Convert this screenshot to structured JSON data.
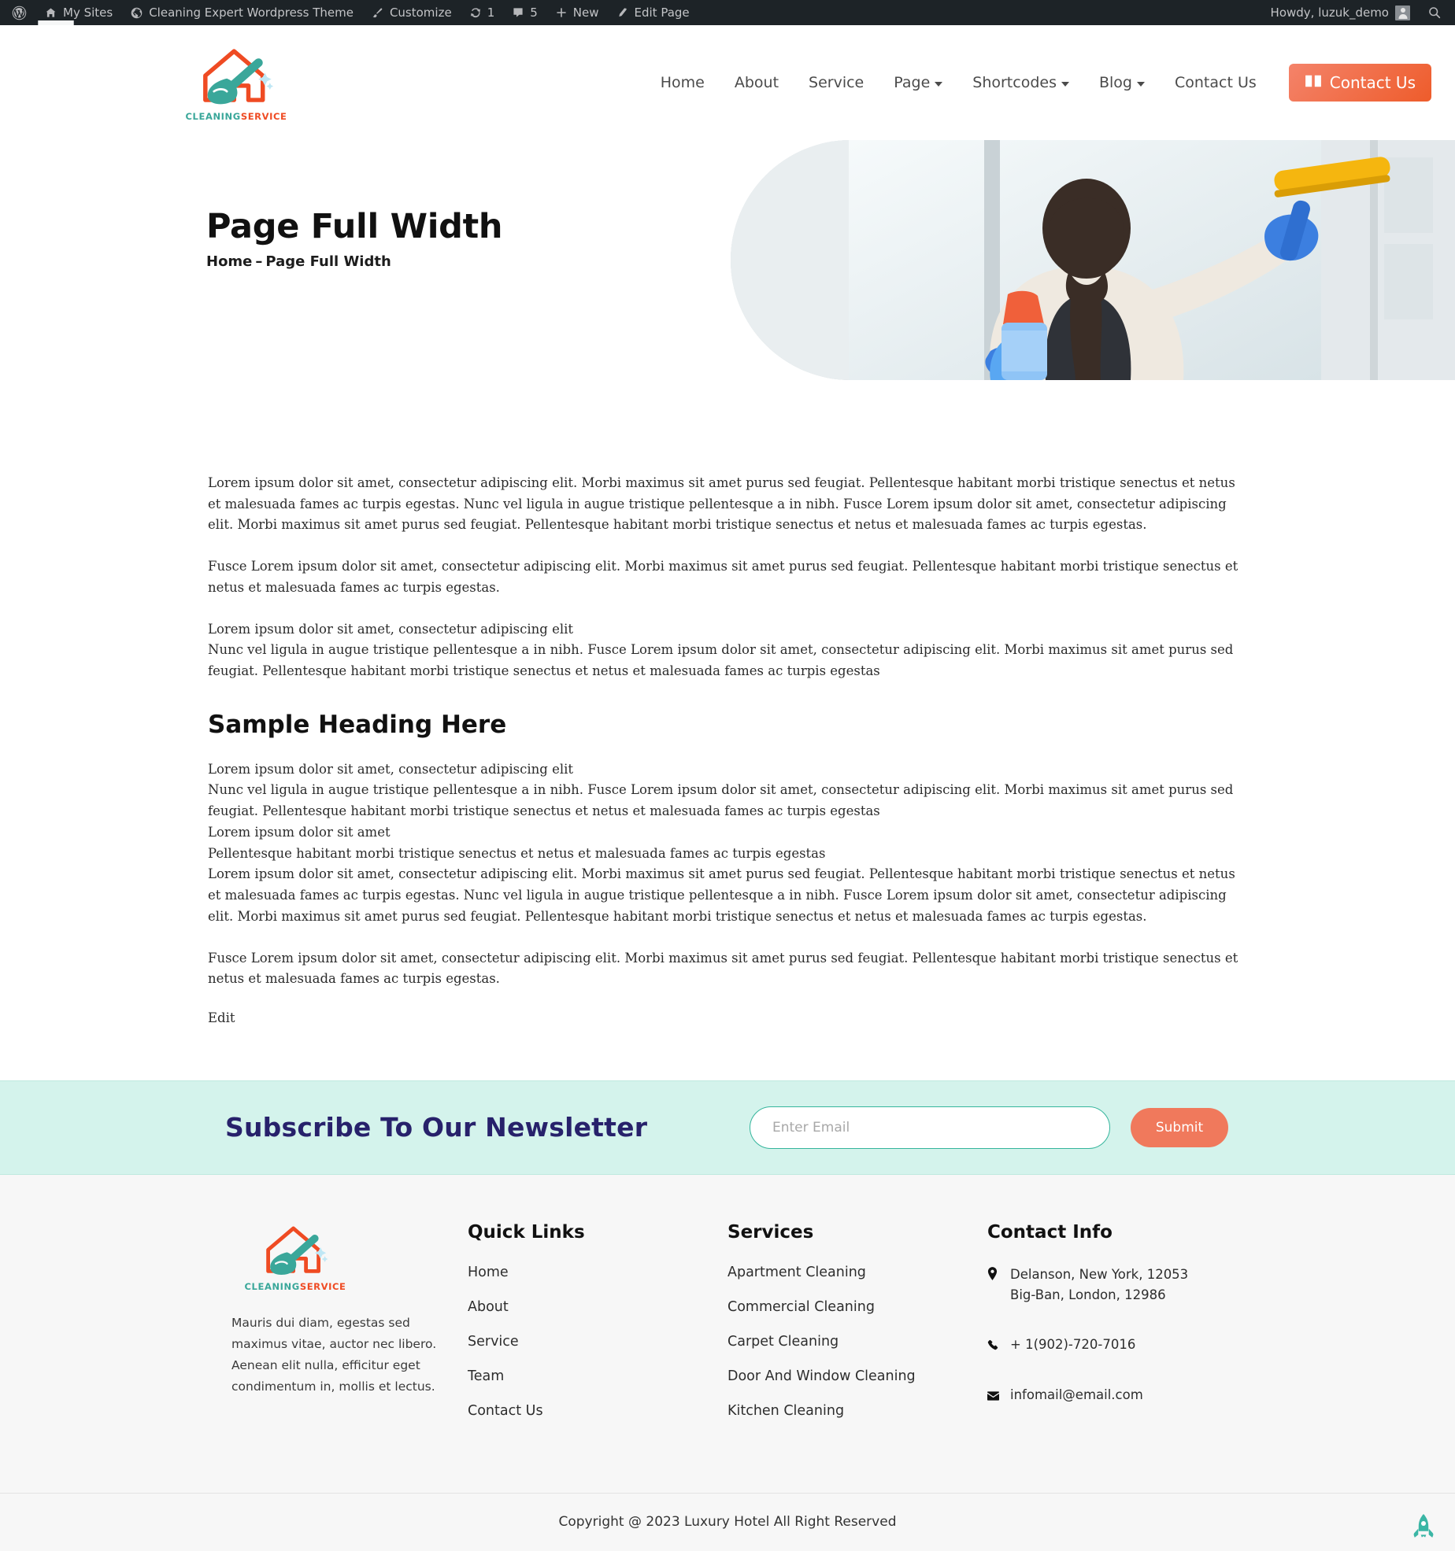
{
  "adminbar": {
    "items": [
      {
        "icon": "wordpress-icon",
        "label": ""
      },
      {
        "icon": "sites-icon",
        "label": "My Sites"
      },
      {
        "icon": "site-icon",
        "label": "Cleaning Expert Wordpress Theme"
      },
      {
        "icon": "brush-icon",
        "label": "Customize"
      },
      {
        "icon": "updates-icon",
        "label": "1"
      },
      {
        "icon": "comments-icon",
        "label": "5"
      },
      {
        "icon": "plus-icon",
        "label": "New"
      },
      {
        "icon": "pencil-icon",
        "label": "Edit Page"
      }
    ],
    "howdy": "Howdy, luzuk_demo",
    "search_icon": "search-icon"
  },
  "header": {
    "logo": {
      "word1": "CLEANING",
      "word2": "SERVICE",
      "icon": "house-broom-logo-icon"
    },
    "nav": [
      {
        "label": "Home",
        "caret": false
      },
      {
        "label": "About",
        "caret": false
      },
      {
        "label": "Service",
        "caret": false
      },
      {
        "label": "Page",
        "caret": true
      },
      {
        "label": "Shortcodes",
        "caret": true
      },
      {
        "label": "Blog",
        "caret": true
      },
      {
        "label": "Contact Us",
        "caret": false
      }
    ],
    "cta": {
      "label": "Contact Us",
      "icon": "book-icon",
      "color": "#ee5c2b"
    }
  },
  "hero": {
    "title": "Page Full Width",
    "crumb_home": "Home",
    "crumb_sep": "–",
    "crumb_current": "Page Full Width",
    "image_alt": "woman-cleaning-window-with-squeegee"
  },
  "main": {
    "paragraphs": [
      "Lorem ipsum dolor sit amet, consectetur adipiscing elit. Morbi maximus sit amet purus sed feugiat. Pellentesque habitant morbi tristique senectus et netus et malesuada fames ac turpis egestas. Nunc vel ligula in augue tristique pellentesque a in nibh. Fusce Lorem ipsum dolor sit amet, consectetur adipiscing elit. Morbi maximus sit amet purus sed feugiat. Pellentesque habitant morbi tristique senectus et netus et malesuada fames ac turpis egestas.",
      "Fusce Lorem ipsum dolor sit amet, consectetur adipiscing elit. Morbi maximus sit amet purus sed feugiat. Pellentesque habitant morbi tristique senectus et netus et malesuada fames ac turpis egestas."
    ],
    "block3_line1": "Lorem ipsum dolor sit amet, consectetur adipiscing elit",
    "block3_line2": "Nunc vel ligula in augue tristique pellentesque a in nibh. Fusce Lorem ipsum dolor sit amet, consectetur adipiscing elit. Morbi maximus sit amet purus sed feugiat. Pellentesque habitant morbi tristique senectus et netus et malesuada fames ac turpis egestas",
    "heading": "Sample Heading Here",
    "block4_line1": "Lorem ipsum dolor sit amet, consectetur adipiscing elit",
    "block4_line2": "Nunc vel ligula in augue tristique pellentesque a in nibh. Fusce Lorem ipsum dolor sit amet, consectetur adipiscing elit. Morbi maximus sit amet purus sed feugiat. Pellentesque habitant morbi tristique senectus et netus et malesuada fames ac turpis egestas",
    "block4_line3": "Lorem ipsum dolor sit amet",
    "block4_line4": "Pellentesque habitant morbi tristique senectus et netus et malesuada fames ac turpis egestas",
    "block4_line5": "Lorem ipsum dolor sit amet, consectetur adipiscing elit. Morbi maximus sit amet purus sed feugiat. Pellentesque habitant morbi tristique senectus et netus et malesuada fames ac turpis egestas. Nunc vel ligula in augue tristique pellentesque a in nibh. Fusce Lorem ipsum dolor sit amet, consectetur adipiscing elit. Morbi maximus sit amet purus sed feugiat. Pellentesque habitant morbi tristique senectus et netus et malesuada fames ac turpis egestas.",
    "last_paragraph": "Fusce Lorem ipsum dolor sit amet, consectetur adipiscing elit. Morbi maximus sit amet purus sed feugiat. Pellentesque habitant morbi tristique senectus et netus et malesuada fames ac turpis egestas.",
    "edit_label": "Edit"
  },
  "newsletter": {
    "title": "Subscribe To Our Newsletter",
    "title_color": "#27216b",
    "placeholder": "Enter Email",
    "value": "",
    "submit_label": "Submit",
    "submit_color": "#f0795c",
    "background": "#d4f3ec"
  },
  "footer": {
    "logo": {
      "word1": "CLEANING",
      "word2": "SERVICE",
      "icon": "house-broom-logo-icon"
    },
    "description": "Mauris dui diam, egestas sed maximus vitae, auctor nec libero. Aenean elit nulla, efficitur eget condimentum in, mollis et lectus.",
    "quick_links": {
      "title": "Quick Links",
      "items": [
        "Home",
        "About",
        "Service",
        "Team",
        "Contact Us"
      ]
    },
    "services": {
      "title": "Services",
      "items": [
        "Apartment Cleaning",
        "Commercial Cleaning",
        "Carpet Cleaning",
        "Door And Window Cleaning",
        "Kitchen Cleaning"
      ]
    },
    "contact": {
      "title": "Contact Info",
      "address_line1": "Delanson, New York, 12053",
      "address_line2": "Big-Ban, London, 12986",
      "phone": "+ 1(902)-720-7016",
      "email": "infomail@email.com",
      "address_icon": "location-pin-icon",
      "phone_icon": "phone-icon",
      "email_icon": "envelope-icon"
    },
    "copyright": "Copyright @ 2023 Luxury Hotel All Right Reserved",
    "to_top_icon": "rocket-icon",
    "to_top_color": "#3bb6a5"
  }
}
